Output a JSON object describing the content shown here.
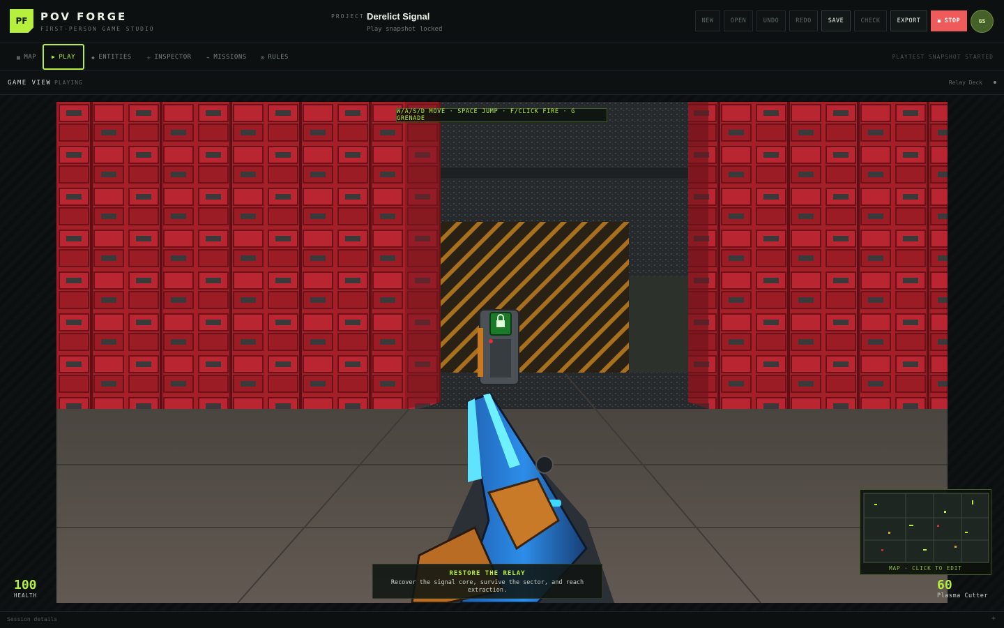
{
  "brand": {
    "logo": "PF",
    "name": "POV FORGE",
    "subtitle": "FIRST-PERSON GAME STUDIO"
  },
  "project": {
    "label": "PROJECT",
    "name": "Derelict Signal",
    "status": "Play snapshot locked"
  },
  "toolbar": {
    "new": "NEW",
    "open": "OPEN",
    "undo": "UNDO",
    "redo": "REDO",
    "save": "SAVE",
    "check": "CHECK",
    "export": "EXPORT",
    "stop": "STOP",
    "stop_icon": "■"
  },
  "user": {
    "initials": "GS"
  },
  "nav": {
    "items": [
      {
        "icon": "▦",
        "label": "MAP"
      },
      {
        "icon": "▶",
        "label": "PLAY"
      },
      {
        "icon": "◆",
        "label": "ENTITIES"
      },
      {
        "icon": "✛",
        "label": "INSPECTOR"
      },
      {
        "icon": "⌁",
        "label": "MISSIONS"
      },
      {
        "icon": "⚙",
        "label": "RULES"
      }
    ],
    "status": "PLAYTEST SNAPSHOT STARTED"
  },
  "view": {
    "title": "GAME VIEW",
    "state": "PLAYING",
    "location": "Relay Deck"
  },
  "hud": {
    "controls_hint": "W/A/S/D MOVE · SPACE JUMP · F/CLICK FIRE · G GRENADE",
    "health_value": "100",
    "health_label": "HEALTH",
    "ammo_value": "60",
    "weapon_name": "Plasma Cutter",
    "mission_title": "RESTORE THE RELAY",
    "mission_desc": "Recover the signal core, survive the sector, and reach extraction.",
    "minimap_caption": "MAP · CLICK TO EDIT"
  },
  "footer": {
    "session": "Session details",
    "plus": "+"
  },
  "colors": {
    "accent": "#b6f03c",
    "stop": "#ef5a5a",
    "wall": "#b4202a",
    "floor": "#5a544d"
  }
}
